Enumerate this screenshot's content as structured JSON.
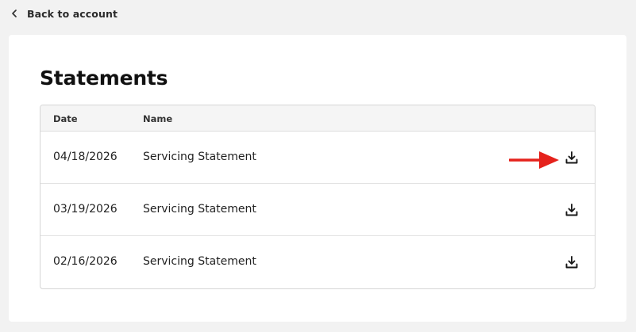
{
  "nav": {
    "back_label": "Back to account",
    "back_icon": "chevron-left-icon"
  },
  "page": {
    "title": "Statements"
  },
  "table": {
    "columns": {
      "date": "Date",
      "name": "Name"
    },
    "rows": [
      {
        "date": "04/18/2026",
        "name": "Servicing Statement",
        "action_icon": "download-icon"
      },
      {
        "date": "03/19/2026",
        "name": "Servicing Statement",
        "action_icon": "download-icon"
      },
      {
        "date": "02/16/2026",
        "name": "Servicing Statement",
        "action_icon": "download-icon"
      }
    ]
  },
  "annotation": {
    "arrow_color": "#e5221c",
    "points_to": "download-icon"
  }
}
